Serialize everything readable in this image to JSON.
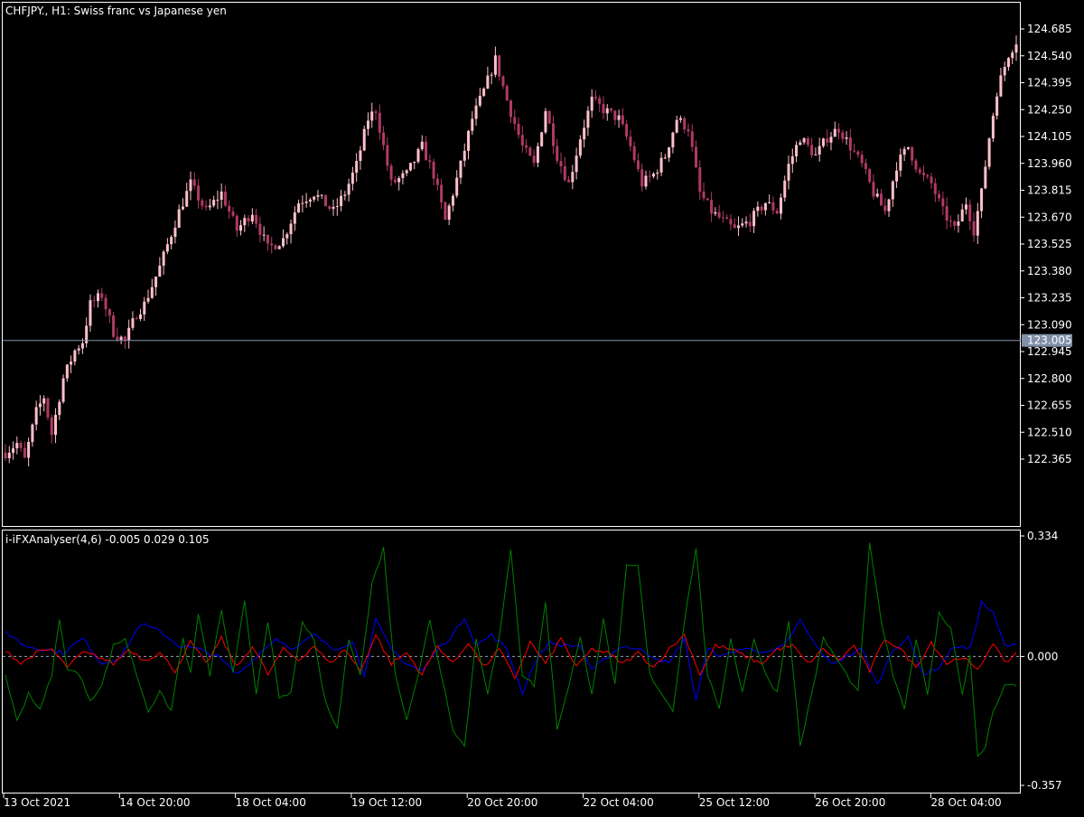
{
  "main_chart": {
    "title": "CHFJPY., H1:  Swiss franc vs Japanese yen",
    "price_ticks": [
      "124.685",
      "124.540",
      "124.395",
      "124.250",
      "124.105",
      "123.960",
      "123.815",
      "123.670",
      "123.525",
      "123.380",
      "123.235",
      "123.090",
      "122.945",
      "122.800",
      "122.655",
      "122.510",
      "122.365"
    ],
    "price_tick_values": [
      124.685,
      124.54,
      124.395,
      124.25,
      124.105,
      123.96,
      123.815,
      123.67,
      123.525,
      123.38,
      123.235,
      123.09,
      122.945,
      122.8,
      122.655,
      122.51,
      122.365
    ],
    "current_price_label": "123.005",
    "current_price_value": 123.005,
    "colors": {
      "bull": "#ffc0cb",
      "bear": "#b03a64",
      "price_line": "#8090a8",
      "price_label_bg": "#8090a8"
    }
  },
  "indicator": {
    "label": "i-iFXAnalyser(4,6) -0.005 0.029 0.105",
    "ticks": [
      "0.334",
      "0.000",
      "-0.357"
    ],
    "tick_values": [
      0.334,
      0.0,
      -0.357
    ],
    "colors": {
      "blue": "#0000ff",
      "red": "#ff0000",
      "green": "#008000",
      "zero_line": "#9aa3b3"
    }
  },
  "time_axis": {
    "labels": [
      "13 Oct 2021",
      "14 Oct 20:00",
      "18 Oct 04:00",
      "19 Oct 12:00",
      "20 Oct 20:00",
      "22 Oct 04:00",
      "25 Oct 12:00",
      "26 Oct 20:00",
      "28 Oct 04:00"
    ]
  },
  "chart_data": {
    "type": "candlestick",
    "price_anchors": [
      [
        0,
        122.4
      ],
      [
        3,
        122.45
      ],
      [
        5,
        122.36
      ],
      [
        8,
        122.62
      ],
      [
        10,
        122.7
      ],
      [
        12,
        122.5
      ],
      [
        15,
        122.8
      ],
      [
        18,
        122.95
      ],
      [
        20,
        123.0
      ],
      [
        22,
        123.2
      ],
      [
        25,
        123.25
      ],
      [
        28,
        123.05
      ],
      [
        31,
        123.0
      ],
      [
        34,
        123.15
      ],
      [
        36,
        123.2
      ],
      [
        40,
        123.4
      ],
      [
        45,
        123.7
      ],
      [
        48,
        123.85
      ],
      [
        52,
        123.7
      ],
      [
        56,
        123.8
      ],
      [
        60,
        123.6
      ],
      [
        64,
        123.7
      ],
      [
        68,
        123.5
      ],
      [
        72,
        123.55
      ],
      [
        76,
        123.75
      ],
      [
        80,
        123.8
      ],
      [
        85,
        123.7
      ],
      [
        88,
        123.8
      ],
      [
        91,
        123.95
      ],
      [
        94,
        124.2
      ],
      [
        96,
        124.25
      ],
      [
        100,
        123.85
      ],
      [
        104,
        123.9
      ],
      [
        108,
        124.05
      ],
      [
        111,
        123.9
      ],
      [
        114,
        123.65
      ],
      [
        118,
        123.95
      ],
      [
        121,
        124.2
      ],
      [
        124,
        124.35
      ],
      [
        127,
        124.52
      ],
      [
        130,
        124.3
      ],
      [
        134,
        124.05
      ],
      [
        137,
        123.95
      ],
      [
        140,
        124.25
      ],
      [
        143,
        124.0
      ],
      [
        146,
        123.85
      ],
      [
        149,
        124.1
      ],
      [
        152,
        124.3
      ],
      [
        155,
        124.25
      ],
      [
        159,
        124.2
      ],
      [
        162,
        124.05
      ],
      [
        165,
        123.85
      ],
      [
        168,
        123.9
      ],
      [
        171,
        124.0
      ],
      [
        174,
        124.2
      ],
      [
        177,
        124.15
      ],
      [
        180,
        123.8
      ],
      [
        183,
        123.7
      ],
      [
        186,
        123.65
      ],
      [
        189,
        123.6
      ],
      [
        193,
        123.65
      ],
      [
        197,
        123.75
      ],
      [
        200,
        123.7
      ],
      [
        203,
        123.95
      ],
      [
        206,
        124.1
      ],
      [
        210,
        124.0
      ],
      [
        213,
        124.1
      ],
      [
        216,
        124.15
      ],
      [
        219,
        124.05
      ],
      [
        222,
        123.95
      ],
      [
        225,
        123.8
      ],
      [
        228,
        123.7
      ],
      [
        231,
        123.95
      ],
      [
        234,
        124.05
      ],
      [
        237,
        123.9
      ],
      [
        240,
        123.85
      ],
      [
        243,
        123.7
      ],
      [
        246,
        123.6
      ],
      [
        249,
        123.75
      ],
      [
        251,
        123.6
      ],
      [
        253,
        123.8
      ],
      [
        255,
        124.1
      ],
      [
        257,
        124.35
      ],
      [
        260,
        124.55
      ],
      [
        262,
        124.62
      ]
    ],
    "candle_count": 263,
    "indicator_series": [
      {
        "color": "blue",
        "anchors": [
          [
            0,
            0.07
          ],
          [
            5,
            0.03
          ],
          [
            10,
            0.02
          ],
          [
            15,
            0.01
          ],
          [
            20,
            0.05
          ],
          [
            25,
            -0.02
          ],
          [
            30,
            0.0
          ],
          [
            35,
            0.09
          ],
          [
            40,
            0.07
          ],
          [
            45,
            0.03
          ],
          [
            50,
            0.02
          ],
          [
            55,
            0.0
          ],
          [
            60,
            -0.05
          ],
          [
            65,
            0.0
          ],
          [
            70,
            0.05
          ],
          [
            75,
            0.02
          ],
          [
            80,
            0.06
          ],
          [
            85,
            0.02
          ],
          [
            90,
            0.04
          ],
          [
            93,
            -0.05
          ],
          [
            96,
            0.1
          ],
          [
            100,
            0.02
          ],
          [
            104,
            -0.02
          ],
          [
            108,
            -0.04
          ],
          [
            112,
            0.02
          ],
          [
            116,
            0.06
          ],
          [
            119,
            0.11
          ],
          [
            122,
            0.03
          ],
          [
            126,
            0.06
          ],
          [
            130,
            0.02
          ],
          [
            134,
            -0.1
          ],
          [
            137,
            -0.02
          ],
          [
            141,
            0.04
          ],
          [
            145,
            0.03
          ],
          [
            149,
            0.03
          ],
          [
            152,
            -0.04
          ],
          [
            156,
            0.0
          ],
          [
            160,
            0.03
          ],
          [
            164,
            0.02
          ],
          [
            168,
            0.0
          ],
          [
            172,
            -0.02
          ],
          [
            176,
            0.05
          ],
          [
            179,
            -0.12
          ],
          [
            182,
            0.02
          ],
          [
            186,
            0.0
          ],
          [
            190,
            0.02
          ],
          [
            194,
            0.02
          ],
          [
            198,
            0.01
          ],
          [
            202,
            0.03
          ],
          [
            206,
            0.1
          ],
          [
            210,
            0.03
          ],
          [
            214,
            -0.02
          ],
          [
            218,
            0.0
          ],
          [
            222,
            0.02
          ],
          [
            226,
            -0.08
          ],
          [
            230,
            0.02
          ],
          [
            234,
            0.05
          ],
          [
            238,
            -0.05
          ],
          [
            242,
            -0.03
          ],
          [
            246,
            0.03
          ],
          [
            250,
            0.02
          ],
          [
            253,
            0.15
          ],
          [
            256,
            0.12
          ],
          [
            259,
            0.03
          ],
          [
            262,
            0.03
          ]
        ]
      },
      {
        "color": "red",
        "anchors": [
          [
            0,
            0.02
          ],
          [
            4,
            -0.02
          ],
          [
            8,
            0.01
          ],
          [
            12,
            0.02
          ],
          [
            16,
            -0.03
          ],
          [
            20,
            0.01
          ],
          [
            24,
            0.0
          ],
          [
            28,
            -0.02
          ],
          [
            32,
            0.02
          ],
          [
            36,
            -0.01
          ],
          [
            40,
            0.01
          ],
          [
            44,
            -0.04
          ],
          [
            48,
            0.04
          ],
          [
            52,
            -0.02
          ],
          [
            56,
            0.05
          ],
          [
            60,
            -0.03
          ],
          [
            64,
            0.03
          ],
          [
            68,
            -0.05
          ],
          [
            72,
            0.02
          ],
          [
            76,
            -0.01
          ],
          [
            80,
            0.03
          ],
          [
            84,
            -0.02
          ],
          [
            88,
            0.02
          ],
          [
            92,
            -0.04
          ],
          [
            96,
            0.06
          ],
          [
            100,
            -0.02
          ],
          [
            104,
            0.01
          ],
          [
            108,
            -0.05
          ],
          [
            112,
            0.03
          ],
          [
            116,
            -0.02
          ],
          [
            120,
            0.04
          ],
          [
            124,
            -0.03
          ],
          [
            128,
            0.02
          ],
          [
            132,
            -0.06
          ],
          [
            136,
            0.04
          ],
          [
            140,
            -0.02
          ],
          [
            144,
            0.05
          ],
          [
            148,
            -0.03
          ],
          [
            152,
            0.02
          ],
          [
            156,
            0.01
          ],
          [
            160,
            -0.02
          ],
          [
            164,
            0.01
          ],
          [
            168,
            -0.03
          ],
          [
            172,
            0.02
          ],
          [
            176,
            0.06
          ],
          [
            180,
            -0.05
          ],
          [
            184,
            0.03
          ],
          [
            188,
            0.02
          ],
          [
            192,
            0.0
          ],
          [
            196,
            -0.02
          ],
          [
            200,
            0.02
          ],
          [
            204,
            0.03
          ],
          [
            208,
            -0.02
          ],
          [
            212,
            0.02
          ],
          [
            216,
            -0.01
          ],
          [
            220,
            0.03
          ],
          [
            224,
            -0.04
          ],
          [
            228,
            0.05
          ],
          [
            232,
            0.02
          ],
          [
            236,
            -0.03
          ],
          [
            240,
            0.04
          ],
          [
            244,
            -0.02
          ],
          [
            248,
            0.0
          ],
          [
            252,
            -0.04
          ],
          [
            256,
            0.04
          ],
          [
            259,
            -0.02
          ],
          [
            262,
            0.01
          ]
        ]
      },
      {
        "color": "green",
        "anchors": [
          [
            0,
            -0.05
          ],
          [
            3,
            -0.18
          ],
          [
            6,
            -0.1
          ],
          [
            9,
            -0.15
          ],
          [
            12,
            -0.05
          ],
          [
            14,
            0.1
          ],
          [
            16,
            -0.03
          ],
          [
            19,
            -0.05
          ],
          [
            22,
            -0.12
          ],
          [
            25,
            -0.08
          ],
          [
            28,
            0.03
          ],
          [
            31,
            0.05
          ],
          [
            34,
            -0.05
          ],
          [
            37,
            -0.15
          ],
          [
            40,
            -0.1
          ],
          [
            43,
            -0.15
          ],
          [
            46,
            0.05
          ],
          [
            48,
            -0.05
          ],
          [
            50,
            0.12
          ],
          [
            53,
            -0.05
          ],
          [
            56,
            0.13
          ],
          [
            59,
            -0.05
          ],
          [
            62,
            0.15
          ],
          [
            65,
            -0.1
          ],
          [
            68,
            0.1
          ],
          [
            71,
            -0.12
          ],
          [
            74,
            -0.1
          ],
          [
            77,
            0.1
          ],
          [
            80,
            0.04
          ],
          [
            83,
            -0.13
          ],
          [
            86,
            -0.2
          ],
          [
            89,
            0.05
          ],
          [
            92,
            -0.05
          ],
          [
            95,
            0.2
          ],
          [
            98,
            0.3
          ],
          [
            101,
            -0.05
          ],
          [
            104,
            -0.17
          ],
          [
            107,
            -0.05
          ],
          [
            110,
            0.1
          ],
          [
            113,
            -0.05
          ],
          [
            116,
            -0.2
          ],
          [
            119,
            -0.25
          ],
          [
            122,
            0.05
          ],
          [
            125,
            -0.1
          ],
          [
            128,
            0.05
          ],
          [
            131,
            0.3
          ],
          [
            134,
            -0.05
          ],
          [
            137,
            -0.08
          ],
          [
            140,
            0.15
          ],
          [
            143,
            -0.2
          ],
          [
            146,
            -0.08
          ],
          [
            149,
            0.05
          ],
          [
            152,
            -0.1
          ],
          [
            155,
            0.1
          ],
          [
            158,
            -0.08
          ],
          [
            161,
            0.25
          ],
          [
            164,
            0.25
          ],
          [
            167,
            -0.05
          ],
          [
            170,
            -0.1
          ],
          [
            173,
            -0.15
          ],
          [
            176,
            0.1
          ],
          [
            179,
            0.3
          ],
          [
            182,
            -0.05
          ],
          [
            185,
            -0.15
          ],
          [
            188,
            0.05
          ],
          [
            191,
            -0.1
          ],
          [
            194,
            0.05
          ],
          [
            197,
            -0.05
          ],
          [
            200,
            -0.1
          ],
          [
            203,
            0.1
          ],
          [
            206,
            -0.25
          ],
          [
            209,
            -0.1
          ],
          [
            212,
            0.05
          ],
          [
            215,
            0.0
          ],
          [
            218,
            -0.05
          ],
          [
            221,
            -0.1
          ],
          [
            224,
            0.31
          ],
          [
            227,
            0.1
          ],
          [
            230,
            -0.05
          ],
          [
            233,
            -0.15
          ],
          [
            236,
            0.05
          ],
          [
            239,
            -0.1
          ],
          [
            242,
            0.12
          ],
          [
            245,
            0.08
          ],
          [
            248,
            -0.1
          ],
          [
            250,
            0.0
          ],
          [
            252,
            -0.28
          ],
          [
            254,
            -0.25
          ],
          [
            256,
            -0.15
          ],
          [
            259,
            -0.08
          ],
          [
            262,
            -0.08
          ]
        ]
      }
    ]
  }
}
